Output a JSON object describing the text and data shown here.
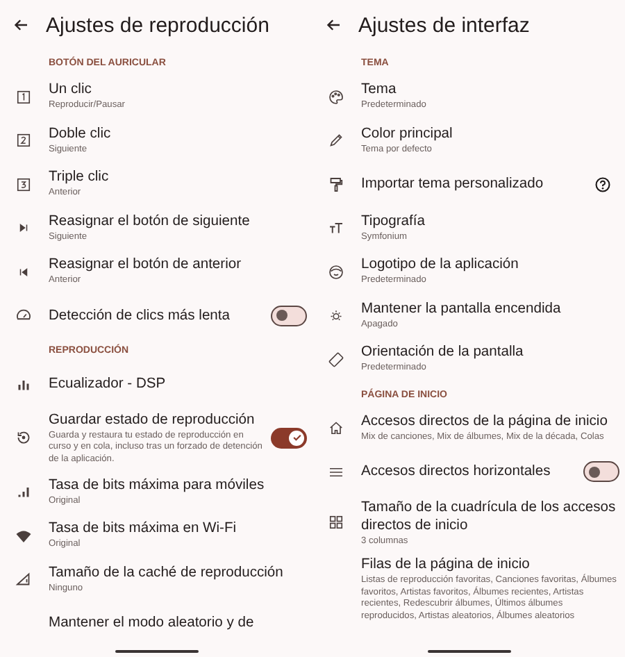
{
  "screens": [
    {
      "title": "Ajustes de reproducción",
      "items": [
        {
          "kind": "section",
          "title": "BOTÓN DEL AURICULAR"
        },
        {
          "kind": "item",
          "title": "Un clic",
          "subtitle": "Reproducir/Pausar"
        },
        {
          "kind": "item",
          "title": "Doble clic",
          "subtitle": "Siguiente"
        },
        {
          "kind": "item",
          "title": "Triple clic",
          "subtitle": "Anterior"
        },
        {
          "kind": "item",
          "title": "Reasignar el botón de siguiente",
          "subtitle": "Siguiente"
        },
        {
          "kind": "item",
          "title": "Reasignar el botón de anterior",
          "subtitle": "Anterior"
        },
        {
          "kind": "switch",
          "title": "Detección de clics más lenta",
          "on": false
        },
        {
          "kind": "section",
          "title": "REPRODUCCIÓN"
        },
        {
          "kind": "item",
          "title": "Ecualizador - DSP"
        },
        {
          "kind": "switch",
          "title": "Guardar estado de reproducción",
          "subtitle": "Guarda y restaura tu estado de reproducción en curso y en cola, incluso tras un forzado de detención de la aplicación.",
          "on": true
        },
        {
          "kind": "item",
          "title": "Tasa de bits máxima para móviles",
          "subtitle": "Original"
        },
        {
          "kind": "item",
          "title": "Tasa de bits máxima en Wi-Fi",
          "subtitle": "Original"
        },
        {
          "kind": "item",
          "title": "Tamaño de la caché de reproducción",
          "subtitle": "Ninguno"
        },
        {
          "kind": "item",
          "title": "Mantener el modo aleatorio y de"
        }
      ]
    },
    {
      "title": "Ajustes de interfaz",
      "items": [
        {
          "kind": "section",
          "title": "TEMA"
        },
        {
          "kind": "item",
          "title": "Tema",
          "subtitle": "Predeterminado"
        },
        {
          "kind": "item",
          "title": "Color principal",
          "subtitle": "Tema por defecto"
        },
        {
          "kind": "help",
          "title": "Importar tema personalizado"
        },
        {
          "kind": "item",
          "title": "Tipografía",
          "subtitle": "Symfonium"
        },
        {
          "kind": "item",
          "title": "Logotipo de la aplicación",
          "subtitle": "Predeterminado"
        },
        {
          "kind": "item",
          "title": "Mantener la pantalla encendida",
          "subtitle": "Apagado"
        },
        {
          "kind": "item",
          "title": "Orientación de la pantalla",
          "subtitle": "Predeterminado"
        },
        {
          "kind": "section",
          "title": "PÁGINA DE INICIO"
        },
        {
          "kind": "item",
          "title": "Accesos directos de la página de inicio",
          "subtitle": "Mix de canciones, Mix de álbumes, Mix de la década, Colas"
        },
        {
          "kind": "switch",
          "title": "Accesos directos horizontales",
          "on": false
        },
        {
          "kind": "item",
          "title": "Tamaño de la cuadrícula de los accesos directos de inicio",
          "subtitle": "3 columnas"
        },
        {
          "kind": "item",
          "title": "Filas de la página de inicio",
          "subtitle": "Listas de reproducción favoritas, Canciones favoritas, Álbumes favoritos, Artistas favoritos, Álbumes recientes, Artistas recientes, Redescubrir álbumes, Últimos álbumes reproducidos, Artistas aleatorios, Álbumes aleatorios"
        }
      ]
    }
  ]
}
